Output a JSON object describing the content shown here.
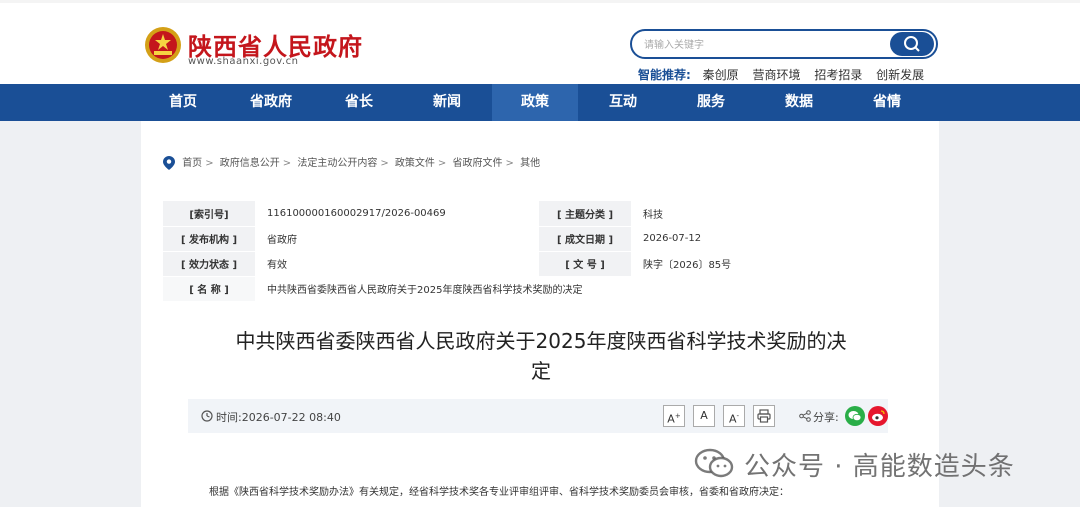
{
  "header": {
    "site_name": "陕西省人民政府",
    "site_url": "www.shaanxi.gov.cn",
    "search_placeholder": "请输入关键字",
    "hot_label": "智能推荐:",
    "hot_items": [
      "秦创原",
      "营商环境",
      "招考招录",
      "创新发展"
    ]
  },
  "nav": {
    "items": [
      "首页",
      "省政府",
      "省长",
      "新闻",
      "政策",
      "互动",
      "服务",
      "数据",
      "省情"
    ],
    "active": "政策"
  },
  "breadcrumb": [
    "首页",
    "政府信息公开",
    "法定主动公开内容",
    "政策文件",
    "省政府文件",
    "其他"
  ],
  "meta": {
    "index_label": "[索引号]",
    "index_value": "116100000160002917/2026-00469",
    "topic_label": "[ 主题分类 ]",
    "topic_value": "科技",
    "issuer_label": "[ 发布机构 ]",
    "issuer_value": "省政府",
    "date_label": "[ 成文日期 ]",
    "date_value": "2026-07-12",
    "status_label": "[ 效力状态 ]",
    "status_value": "有效",
    "docno_label": "[ 文 号 ]",
    "docno_value": "陕字〔2026〕85号",
    "name_label": "[ 名 称 ]",
    "name_value": "中共陕西省委陕西省人民政府关于2025年度陕西省科学技术奖励的决定"
  },
  "article": {
    "title_line1": "中共陕西省委陕西省人民政府关于2025年度陕西省科学技术奖励的决",
    "title_line2": "定",
    "time_label": "时间:",
    "time_value": "2026-07-22 08:40",
    "font_large": "A",
    "font_medium": "A",
    "font_small": "A",
    "share_label": "分享:",
    "first_paragraph": "根据《陕西省科学技术奖励办法》有关规定，经省科学技术奖各专业评审组评审、省科学技术奖励委员会审核，省委和省政府决定："
  },
  "watermark": {
    "text": "公众号 · 高能数造头条"
  },
  "colors": {
    "brand_blue": "#1a4f96",
    "brand_red": "#c4161c",
    "wechat_green": "#2aae48",
    "weibo_red": "#e6162d"
  }
}
